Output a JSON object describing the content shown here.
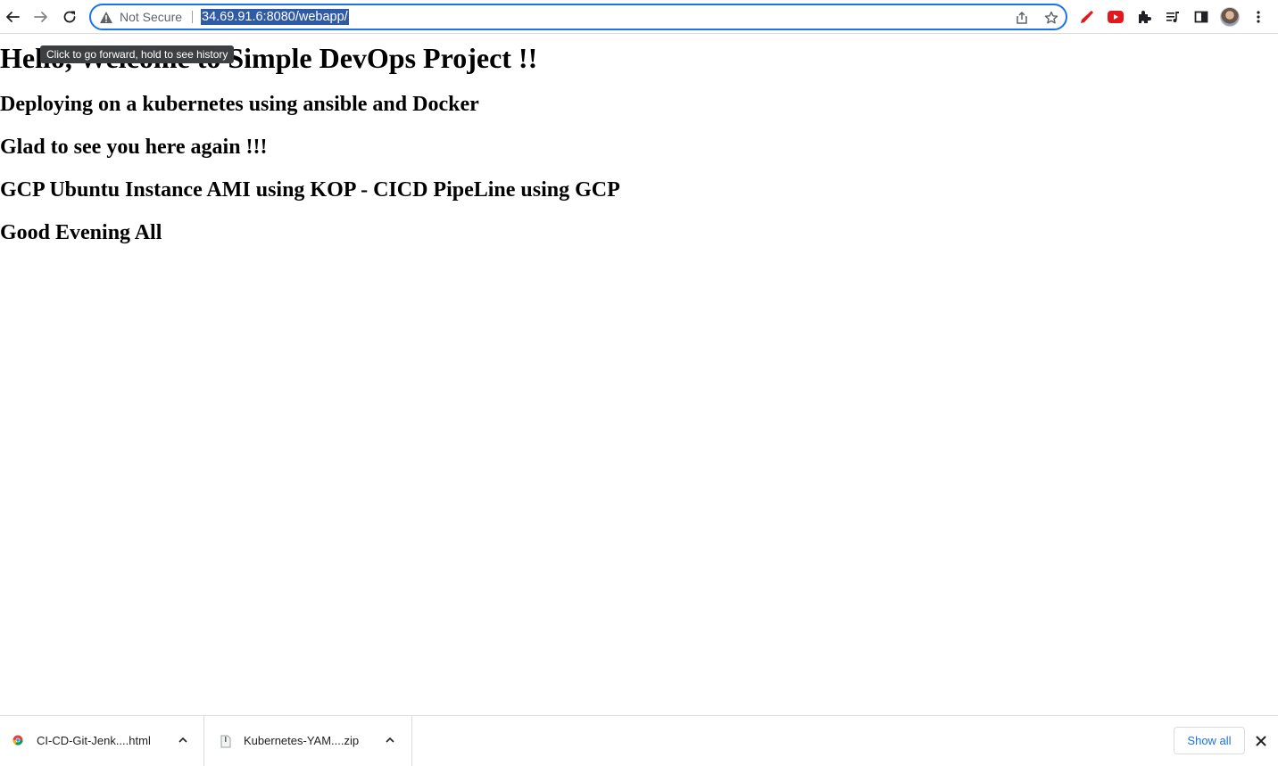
{
  "browser": {
    "security_label": "Not Secure",
    "url": "34.69.91.6:8080/webapp/",
    "tooltip": "Click to go forward, hold to see history",
    "icons": [
      "back-arrow-icon",
      "forward-arrow-icon",
      "reload-icon",
      "warning-icon",
      "share-icon",
      "star-icon",
      "pen-extension-icon",
      "youtube-extension-icon",
      "puzzle-icon",
      "media-icon",
      "side-panel-icon",
      "avatar",
      "more-vert-icon"
    ],
    "colors": {
      "focus": "#1a73e8",
      "selection": "#2f5aa8",
      "extension_red": "#e0191f"
    }
  },
  "page": {
    "heading": "Hello, Welcome to Simple DevOps Project !!",
    "lines": [
      "Deploying on a kubernetes using ansible and Docker",
      "Glad to see you here again !!!",
      "GCP Ubuntu Instance AMI using KOP - CICD PipeLine using GCP",
      "Good Evening All"
    ]
  },
  "downloads": {
    "items": [
      {
        "name": "CI-CD-Git-Jenk....html",
        "icon": "chrome-file-icon"
      },
      {
        "name": "Kubernetes-YAM....zip",
        "icon": "zip-file-icon"
      }
    ],
    "show_all_label": "Show all",
    "close_icon": "close-icon"
  }
}
